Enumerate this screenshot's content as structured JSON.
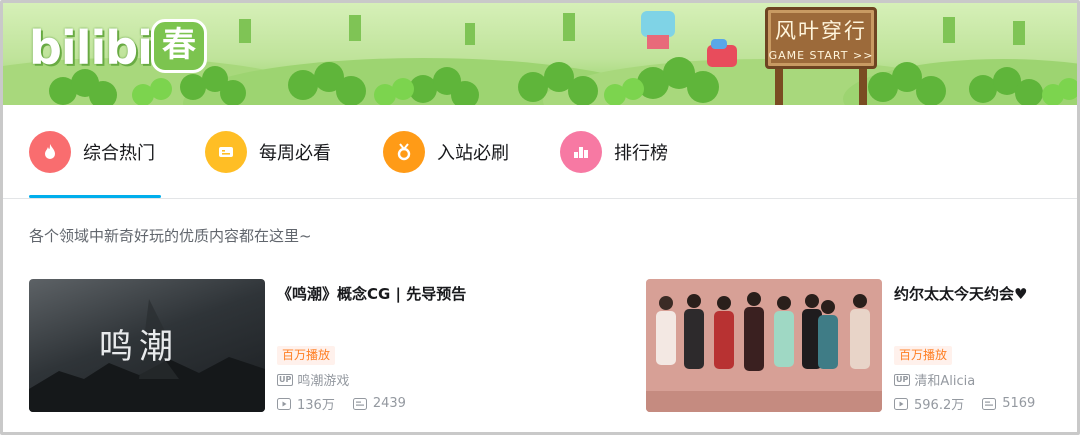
{
  "banner": {
    "logo_text": "bilibili",
    "logo_badge": "春",
    "sign_title": "风叶穿行",
    "sign_subtitle": "GAME START >>"
  },
  "tabs": [
    {
      "label": "综合热门",
      "icon": "flame-icon",
      "color": "#f96d6f",
      "active": true
    },
    {
      "label": "每周必看",
      "icon": "ticket-icon",
      "color": "#ffbe25",
      "active": false
    },
    {
      "label": "入站必刷",
      "icon": "medal-icon",
      "color": "#ff9b17",
      "active": false
    },
    {
      "label": "排行榜",
      "icon": "ranking-icon",
      "color": "#f779a3",
      "active": false
    }
  ],
  "accent_color": "#00aeec",
  "intro": "各个领域中新奇好玩的优质内容都在这里~",
  "cards": [
    {
      "thumb_text": "鸣潮",
      "title": "《鸣潮》概念CG | 先导预告",
      "badge": "百万播放",
      "up_tag": "UP",
      "uploader": "鸣潮游戏",
      "views": "136万",
      "comments": "2439"
    },
    {
      "thumb_text": "",
      "title": "约尔太太今天约会♥",
      "badge": "百万播放",
      "up_tag": "UP",
      "uploader": "清和Alicia",
      "views": "596.2万",
      "comments": "5169"
    }
  ]
}
